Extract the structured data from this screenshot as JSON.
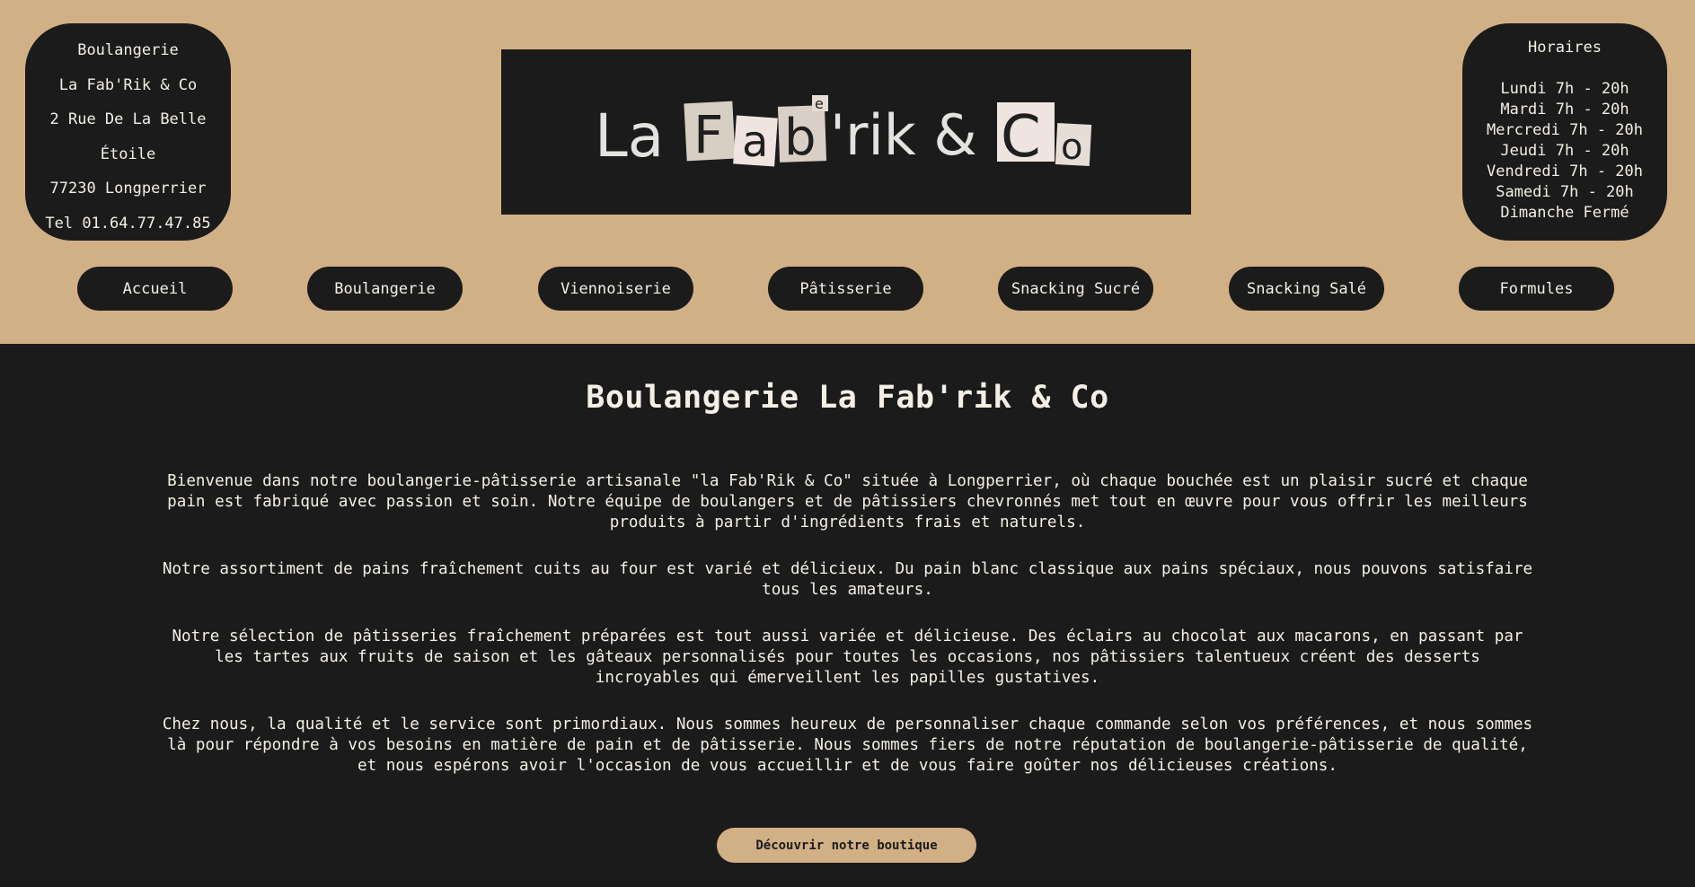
{
  "address": {
    "lines": [
      "Boulangerie",
      "La Fab'Rik & Co",
      "2 Rue De La Belle",
      "Étoile",
      "77230 Longperrier",
      "Tel 01.64.77.47.85"
    ]
  },
  "logo": {
    "text_la": "La",
    "letters": [
      "F",
      "a",
      "b"
    ],
    "superscript_e": "e",
    "text_rik": "'rik &",
    "letters_co": [
      "C",
      "o"
    ]
  },
  "hours": {
    "title": "Horaires",
    "lines": [
      "Lundi 7h - 20h",
      "Mardi 7h - 20h",
      "Mercredi 7h - 20h",
      "Jeudi 7h - 20h",
      "Vendredi 7h - 20h",
      "Samedi 7h - 20h",
      "Dimanche Fermé"
    ]
  },
  "nav": {
    "items": [
      "Accueil",
      "Boulangerie",
      "Viennoiserie",
      "Pâtisserie",
      "Snacking Sucré",
      "Snacking Salé",
      "Formules"
    ]
  },
  "main": {
    "title": "Boulangerie La Fab'rik & Co",
    "paragraphs": [
      "Bienvenue dans notre boulangerie-pâtisserie artisanale \"la Fab'Rik & Co\" située à Longperrier, où chaque bouchée est un plaisir sucré et chaque pain est fabriqué avec passion et soin. Notre équipe de boulangers et de pâtissiers chevronnés met tout en œuvre pour vous offrir les meilleurs produits à partir d'ingrédients frais et naturels.",
      "Notre assortiment de pains fraîchement cuits au four est varié et délicieux. Du pain blanc classique aux pains spéciaux, nous pouvons satisfaire tous les amateurs.",
      "Notre sélection de pâtisseries fraîchement préparées est tout aussi variée et délicieuse. Des éclairs au chocolat aux macarons, en passant par les tartes aux fruits de saison et les gâteaux personnalisés pour toutes les occasions, nos pâtissiers talentueux créent des desserts incroyables qui émerveillent les papilles gustatives.",
      "Chez nous, la qualité et le service sont primordiaux. Nous sommes heureux de personnaliser chaque commande selon vos préférences, et nous sommes là pour répondre à vos besoins en matière de pain et de pâtisserie. Nous sommes fiers de notre réputation de boulangerie-pâtisserie de qualité, et nous espérons avoir l'occasion de vous accueillir et de vous faire goûter nos délicieuses créations."
    ],
    "cta": "Découvrir notre boutique"
  },
  "colors": {
    "accent": "#d2b086",
    "dark": "#1b1b1b",
    "text_light": "#f4efe6"
  }
}
